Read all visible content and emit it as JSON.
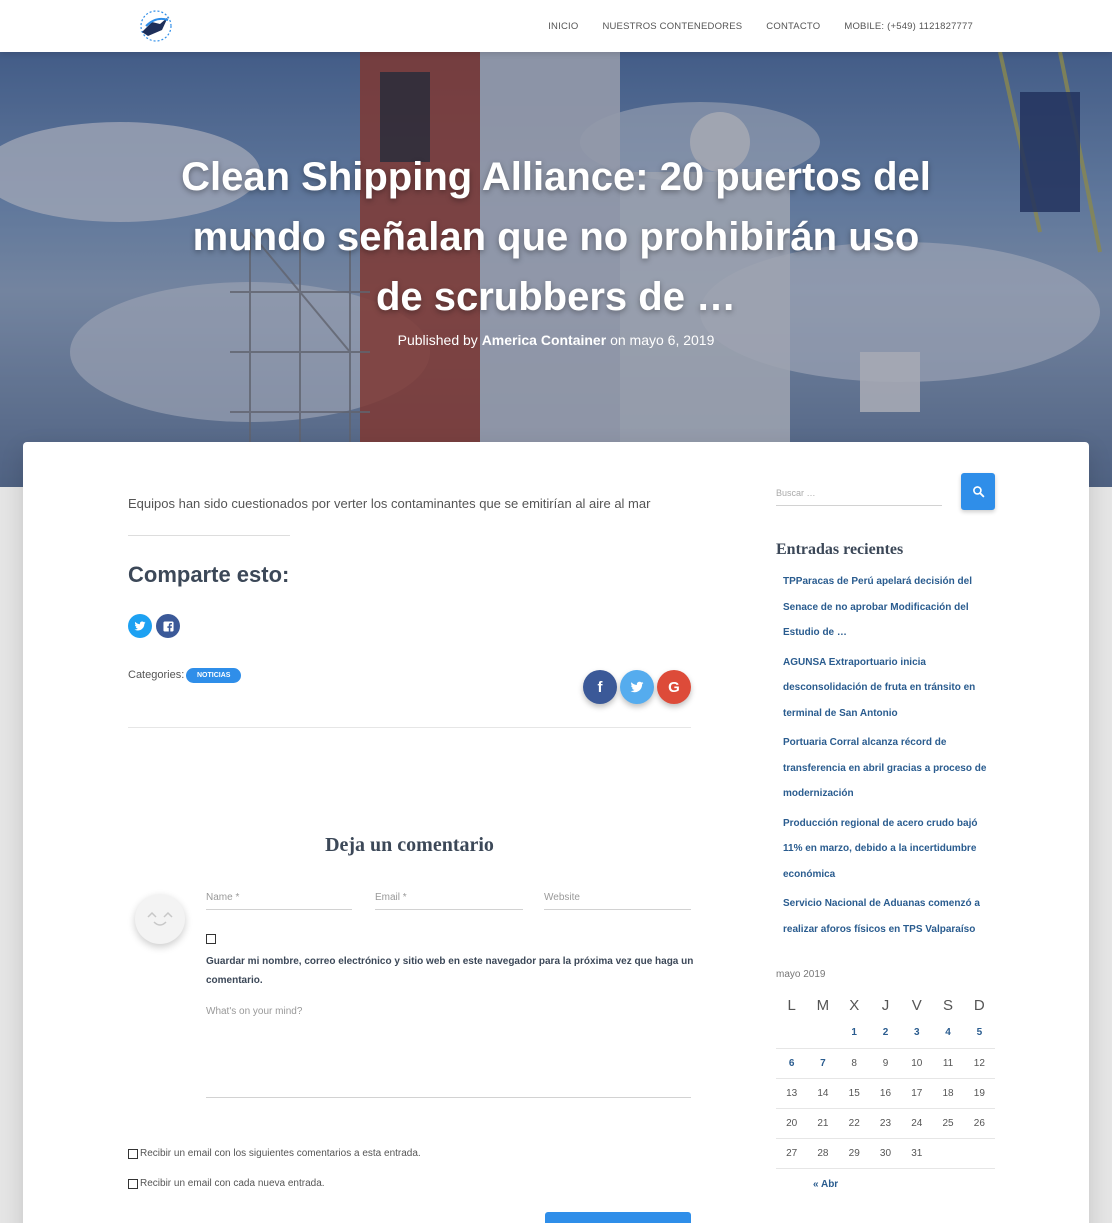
{
  "nav": {
    "items": [
      {
        "label": "INICIO"
      },
      {
        "label": "NUESTROS CONTENEDORES"
      },
      {
        "label": "CONTACTO"
      },
      {
        "label": "MOBILE: (+549) 1121827777"
      }
    ]
  },
  "hero": {
    "title": "Clean Shipping Alliance: 20 puertos del mundo señalan que no prohibirán uso de scrubbers de …",
    "published_by": "Published by",
    "author": "America Container",
    "on": "on",
    "date": "mayo 6, 2019"
  },
  "post": {
    "excerpt": "Equipos han sido cuestionados por verter los contaminantes que se emitirían al aire al mar",
    "share_heading": "Comparte esto:",
    "categories_label": "Categories:",
    "category": "NOTICIAS"
  },
  "comments": {
    "heading": "Deja un comentario",
    "name_placeholder": "Name *",
    "email_placeholder": "Email *",
    "website_placeholder": "Website",
    "save_info": "Guardar mi nombre, correo electrónico y sitio web en este navegador para la próxima vez que haga un comentario.",
    "message_placeholder": "What's on your mind?",
    "subscribe_comments": "Recibir un email con los siguientes comentarios a esta entrada.",
    "subscribe_posts": "Recibir un email con cada nueva entrada."
  },
  "sidebar": {
    "search_placeholder": "Buscar …",
    "recent_heading": "Entradas recientes",
    "recent": [
      "TPParacas de Perú apelará decisión del Senace de no aprobar Modificación del Estudio de …",
      "AGUNSA Extraportuario inicia desconsolidación de fruta en tránsito en terminal de San Antonio",
      "Portuaria Corral alcanza récord de transferencia en abril gracias a proceso de modernización",
      "Producción regional de acero crudo bajó 11% en marzo, debido a la incertidumbre económica",
      "Servicio Nacional de Aduanas comenzó a realizar aforos físicos en TPS Valparaíso"
    ],
    "calendar": {
      "caption": "mayo 2019",
      "weekdays": [
        "L",
        "M",
        "X",
        "J",
        "V",
        "S",
        "D"
      ],
      "weeks": [
        [
          "",
          "",
          "1",
          "2",
          "3",
          "4",
          "5"
        ],
        [
          "6",
          "7",
          "8",
          "9",
          "10",
          "11",
          "12"
        ],
        [
          "13",
          "14",
          "15",
          "16",
          "17",
          "18",
          "19"
        ],
        [
          "20",
          "21",
          "22",
          "23",
          "24",
          "25",
          "26"
        ],
        [
          "27",
          "28",
          "29",
          "30",
          "31",
          "",
          ""
        ]
      ],
      "linked_days": [
        "1",
        "2",
        "3",
        "4",
        "5",
        "6",
        "7"
      ],
      "prev": "« Abr"
    }
  },
  "colors": {
    "accent": "#2f8ee9",
    "link": "#2a5c8f",
    "facebook": "#3b5998",
    "twitter": "#55acee",
    "google": "#dd4b39"
  }
}
